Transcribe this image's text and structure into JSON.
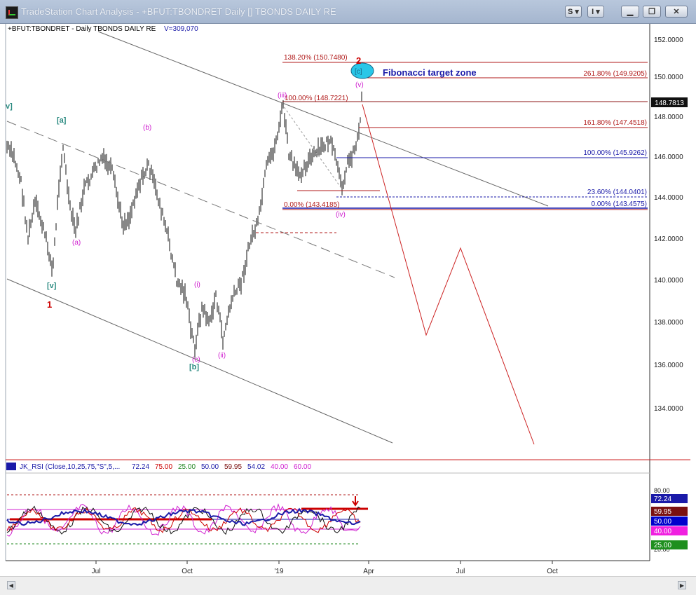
{
  "window": {
    "title": "TradeStation Chart Analysis - +BFUT:TBONDRET Daily [] TBONDS DAILY RE",
    "buttons": [
      {
        "name": "symbol-link-button",
        "label": "S ▾"
      },
      {
        "name": "indicator-link-button",
        "label": "I ▾"
      }
    ]
  },
  "chart_data": {
    "type": "table",
    "symbol_label": "+BFUT:TBONDRET - Daily  TBONDS DAILY RE",
    "volume_label": "V=309,070",
    "price_axis": [
      "152.0000",
      "150.0000",
      "148.0000",
      "146.0000",
      "144.0000",
      "142.0000",
      "140.0000",
      "138.0000",
      "136.0000",
      "134.0000"
    ],
    "last_price": "148.7813",
    "time_axis": [
      "Jul",
      "Oct",
      "'19",
      "Apr",
      "Jul",
      "Oct"
    ],
    "fib_right": [
      "261.80% (149.9205)",
      "161.80% (147.4518)",
      "100.00% (145.9262)",
      "23.60% (144.0401)",
      "0.00% (143.4575)"
    ],
    "fib_left": [
      "138.20% (150.7480)",
      "100.00% (148.7221)",
      "0.00% (143.4185)"
    ],
    "target_zone_label": "Fibonacci target zone",
    "wave_labels": {
      "w_v_cyan": "[v]",
      "w_a_cyan": "[a]",
      "w_b_cyan": "[b]",
      "w_c_cyan": "[c]",
      "w_b_pink": "(b)",
      "w_a_pink": "(a)",
      "w_c_pink": "(c)",
      "w_i_pink": "(i)",
      "w_ii_pink": "(ii)",
      "w_iii_pink": "(iii)",
      "w_iv_pink": "(iv)",
      "w_v_pink": "(v)",
      "w_1_red": "1",
      "w_2_red": "2",
      "edge_mark": "v]"
    },
    "rsi": {
      "title": "JK_RSI (Close,10,25,75,\"S\",5,...",
      "values": [
        "72.24",
        "75.00",
        "25.00",
        "50.00",
        "59.95",
        "54.02",
        "40.00",
        "60.00"
      ],
      "axis": [
        "80.00",
        "20.00"
      ],
      "badges": [
        "72.24",
        "59.95",
        "50.00",
        "40.00",
        "25.00"
      ]
    },
    "colors": {
      "bars": "#111111",
      "red": "#cc0000",
      "blue": "#1a1aa8",
      "teal": "#2a8a80",
      "magenta": "#d020d0",
      "cyan": "#29c7e8",
      "fib_blue": "#1a1aa8",
      "fib_red": "#b01818"
    }
  }
}
